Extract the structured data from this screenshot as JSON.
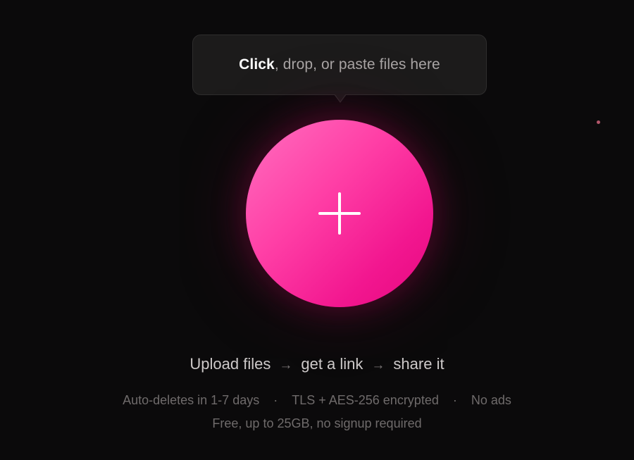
{
  "tooltip": {
    "bold": "Click",
    "rest": ", drop, or paste files here"
  },
  "upload_button": {
    "icon": "plus-icon",
    "accent_start": "#ff6fbf",
    "accent_end": "#e6087f"
  },
  "steps": {
    "step1": "Upload files",
    "step2": "get a link",
    "step3": "share it",
    "arrow": "→"
  },
  "features": {
    "item1": "Auto-deletes in 1-7 days",
    "item2": "TLS + AES-256 encrypted",
    "item3": "No ads",
    "separator": "·"
  },
  "note": "Free, up to 25GB, no signup required"
}
